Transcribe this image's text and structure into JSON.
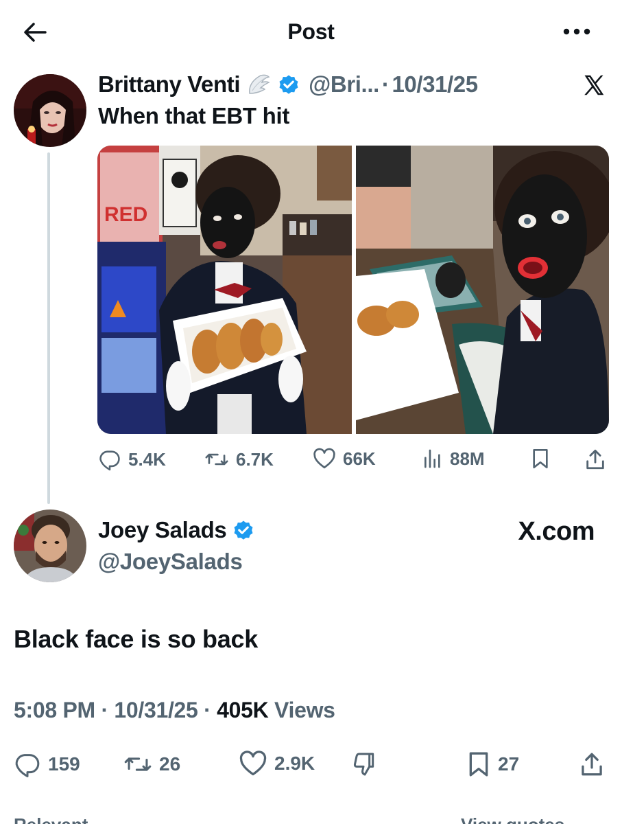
{
  "header": {
    "title": "Post"
  },
  "quoted_post": {
    "author_name": "Brittany Venti",
    "handle": "@Bri...",
    "separator": "·",
    "date": "10/31/25",
    "text": "When that EBT hit",
    "stats": {
      "replies": "5.4K",
      "reposts": "6.7K",
      "likes": "66K",
      "views": "88M"
    },
    "images": [
      "photo-left",
      "photo-right"
    ]
  },
  "reply": {
    "author_name": "Joey Salads",
    "handle": "@JoeySalads",
    "source_label": "X.com",
    "text": "Black face is so back",
    "meta": {
      "time": "5:08 PM",
      "sep1": "·",
      "date": "10/31/25",
      "sep2": "·",
      "views_count": "405K",
      "views_label": "Views"
    },
    "stats": {
      "replies": "159",
      "reposts": "26",
      "likes": "2.9K",
      "bookmarks": "27"
    }
  },
  "bottom": {
    "left_label": "Relevant",
    "right_label": "View quotes"
  },
  "colors": {
    "text_primary": "#0f1419",
    "text_secondary": "#536471",
    "verified_blue": "#1d9bf0",
    "thread_line": "#cfd9de"
  },
  "icons": [
    "back-arrow-icon",
    "more-icon",
    "verified-badge-icon",
    "wing-emoji-icon",
    "x-logo-icon",
    "reply-icon",
    "repost-icon",
    "like-icon",
    "views-icon",
    "bookmark-icon",
    "share-icon",
    "dislike-icon"
  ]
}
